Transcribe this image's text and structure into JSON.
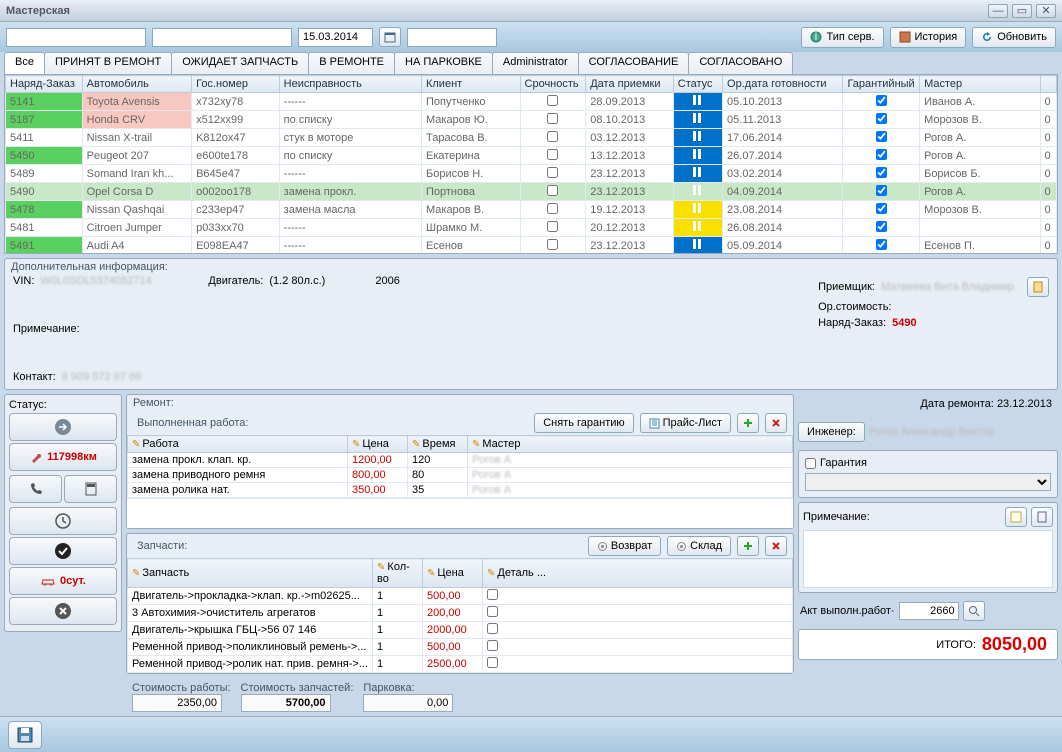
{
  "window": {
    "title": "Мастерская"
  },
  "toolbar": {
    "date": "15.03.2014",
    "btn_tip_serv": "Тип серв.",
    "btn_history": "История",
    "btn_refresh": "Обновить"
  },
  "tabs": [
    "Все",
    "ПРИНЯТ В РЕМОНТ",
    "ОЖИДАЕТ ЗАПЧАСТЬ",
    "В РЕМОНТЕ",
    "НА ПАРКОВКЕ",
    "Administrator",
    "СОГЛАСОВАНИЕ",
    "СОГЛАСОВАНО"
  ],
  "grid": {
    "cols": [
      "Наряд-Заказ",
      "Автомобиль",
      "Гос.номер",
      "Неисправность",
      "Клиент",
      "Срочность",
      "Дата приемки",
      "Статус",
      "Ор.дата готовности",
      "Гарантийный",
      "Мастер",
      ""
    ],
    "rows": [
      {
        "id": "5141",
        "auto": "Toyota Avensis",
        "plate": "x732xy78",
        "fault": "------",
        "client": "Попутченко",
        "date": "28.09.2013",
        "status": "blue",
        "ready": "05.10.2013",
        "war": true,
        "master": "Иванов А.",
        "idcls": "cell-green",
        "autocls": "cell-pink"
      },
      {
        "id": "5187",
        "auto": "Honda CRV",
        "plate": "x512xx99",
        "fault": "по списку",
        "client": "Макаров Ю.",
        "date": "08.10.2013",
        "status": "blue",
        "ready": "05.11.2013",
        "war": true,
        "master": "Морозов В.",
        "idcls": "cell-green",
        "autocls": "cell-pink"
      },
      {
        "id": "5411",
        "auto": "Nissan X-trail",
        "plate": "K812ox47",
        "fault": "стук в моторе",
        "client": "Тарасова В.",
        "date": "03.12.2013",
        "status": "blue",
        "ready": "17.06.2014",
        "war": true,
        "master": "Рогов А.",
        "idcls": ""
      },
      {
        "id": "5450",
        "auto": "Peugeot 207",
        "plate": "e600te178",
        "fault": "по списку",
        "client": "Екатерина",
        "date": "13.12.2013",
        "status": "blue",
        "ready": "26.07.2014",
        "war": true,
        "master": "Рогов А.",
        "idcls": "cell-green"
      },
      {
        "id": "5489",
        "auto": "Somand Iran kh...",
        "plate": "B645e47",
        "fault": "------",
        "client": "Борисов Н.",
        "date": "23.12.2013",
        "status": "blue",
        "ready": "03.02.2014",
        "war": true,
        "master": "Борисов Б.",
        "idcls": ""
      },
      {
        "id": "5490",
        "auto": "Opel Corsa D",
        "plate": "o002oo178",
        "fault": "замена прокл.",
        "client": "Портнова",
        "date": "23.12.2013",
        "status": "blue",
        "ready": "04.09.2014",
        "war": true,
        "master": "Рогов А.",
        "idcls": "cell-green",
        "sel": true
      },
      {
        "id": "5478",
        "auto": "Nissan Qashqai",
        "plate": "c233ep47",
        "fault": "замена масла",
        "client": "Макаров В.",
        "date": "19.12.2013",
        "status": "yellow",
        "ready": "23.08.2014",
        "war": true,
        "master": "Морозов В.",
        "idcls": "cell-green"
      },
      {
        "id": "5481",
        "auto": "Citroen Jumper",
        "plate": "p033xx70",
        "fault": "------",
        "client": "Шрамко М.",
        "date": "20.12.2013",
        "status": "yellow",
        "ready": "26.08.2014",
        "war": true,
        "master": "",
        "idcls": ""
      },
      {
        "id": "5491",
        "auto": "Audi A4",
        "plate": "E098EA47",
        "fault": "------",
        "client": "Есенов",
        "date": "23.12.2013",
        "status": "blue",
        "ready": "05.09.2014",
        "war": true,
        "master": "Есенов П.",
        "idcls": "cell-green"
      }
    ]
  },
  "info": {
    "legend": "Дополнительная информация:",
    "vin_label": "VIN:",
    "vin": "W0L0SDL5374052714",
    "engine_label": "Двигатель:",
    "engine": "(1.2 80л.с.)",
    "year": "2006",
    "note_label": "Примечание:",
    "contact_label": "Контакт:",
    "contact": "8 909 572 67 66",
    "receiver_label": "Приемщик:",
    "receiver": "Матвеева Вита Владимир",
    "est_label": "Ор.стоимость:",
    "order_label": "Наряд-Заказ:",
    "order": "5490"
  },
  "status_panel": {
    "legend": "Статус:",
    "mileage": "117998км",
    "btn_days": "0сут."
  },
  "repair": {
    "legend": "Ремонт:",
    "sub": "Выполненная работа:",
    "btn_remove": "Снять гарантию",
    "btn_price": "Прайс-Лист",
    "date_label": "Дата ремонта:",
    "date": "23.12.2013",
    "cols": [
      "Работа",
      "Цена",
      "Время",
      "Мастер"
    ],
    "rows": [
      {
        "work": "замена прокл. клап. кр.",
        "price": "1200,00",
        "time": "120",
        "master": "Рогов А"
      },
      {
        "work": "замена приводного ремня",
        "price": "800,00",
        "time": "80",
        "master": "Рогов А"
      },
      {
        "work": "замена ролика нат.",
        "price": "350,00",
        "time": "35",
        "master": "Рогов А"
      }
    ]
  },
  "parts": {
    "legend": "Запчасти:",
    "btn_return": "Возврат",
    "btn_stock": "Склад",
    "cols": [
      "Запчасть",
      "Кол-во",
      "Цена",
      "Деталь ..."
    ],
    "rows": [
      {
        "name": "Двигатель->прокладка->клап. кр.->m02625...",
        "qty": "1",
        "price": "500,00"
      },
      {
        "name": "3 Автохимия->очиститель агрегатов",
        "qty": "1",
        "price": "200,00"
      },
      {
        "name": "Двигатель->крышка ГБЦ->56 07 146",
        "qty": "1",
        "price": "2000,00"
      },
      {
        "name": "Ременной привод->поликлиновый ремень->...",
        "qty": "1",
        "price": "500,00"
      },
      {
        "name": "Ременной привод->ролик нат. прив. ремня->...",
        "qty": "1",
        "price": "2500,00"
      }
    ]
  },
  "right": {
    "engineer_label": "Инженер:",
    "engineer": "Рогов Александр Виктор",
    "warranty": "Гарантия",
    "note_label": "Примечание:",
    "act_label": "Акт выполн.работ·",
    "act": "2660"
  },
  "totals": {
    "work_label": "Стоимость работы:",
    "work": "2350,00",
    "parts_label": "Стоимость запчастей:",
    "parts": "5700,00",
    "park_label": "Парковка:",
    "park": "0,00",
    "total_label": "ИТОГО:",
    "total": "8050,00"
  }
}
